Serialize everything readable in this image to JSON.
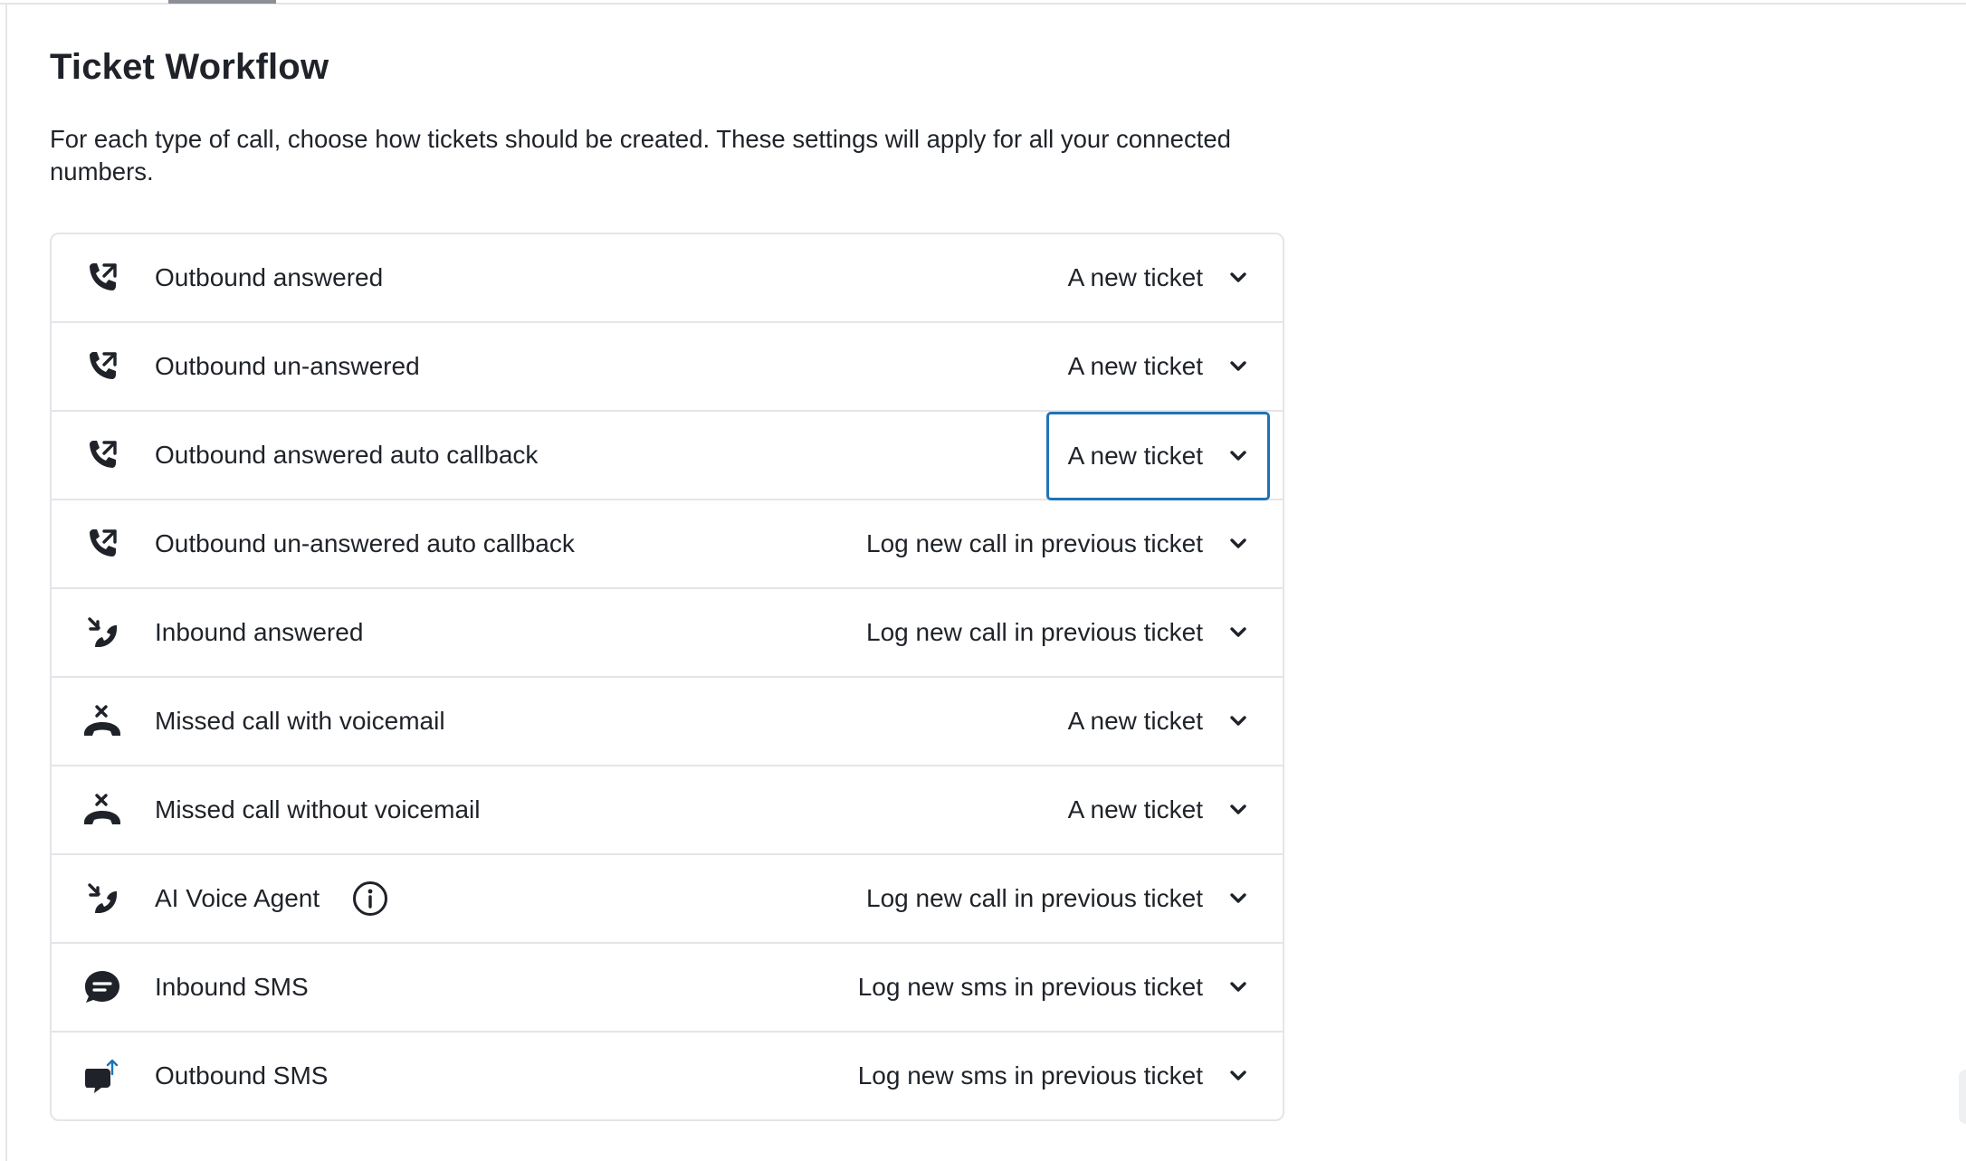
{
  "header": {
    "title": "Ticket Workflow",
    "description": "For each type of call, choose how tickets should be created. These settings will apply for all your connected numbers."
  },
  "rows": [
    {
      "label": "Outbound answered",
      "value": "A new ticket",
      "icon": "outbound-call-icon"
    },
    {
      "label": "Outbound un-answered",
      "value": "A new ticket",
      "icon": "outbound-call-icon"
    },
    {
      "label": "Outbound answered auto callback",
      "value": "A new ticket",
      "icon": "outbound-call-icon",
      "focused": true
    },
    {
      "label": "Outbound un-answered auto callback",
      "value": "Log new call in previous ticket",
      "icon": "outbound-call-icon"
    },
    {
      "label": "Inbound answered",
      "value": "Log new call in previous ticket",
      "icon": "inbound-call-icon"
    },
    {
      "label": "Missed call with voicemail",
      "value": "A new ticket",
      "icon": "missed-call-icon"
    },
    {
      "label": "Missed call without voicemail",
      "value": "A new ticket",
      "icon": "missed-call-icon"
    },
    {
      "label": "AI Voice Agent",
      "value": "Log new call in previous ticket",
      "icon": "inbound-call-icon",
      "info_icon": "info-icon"
    },
    {
      "label": "Inbound SMS",
      "value": "Log new sms in previous ticket",
      "icon": "sms-bubble-icon"
    },
    {
      "label": "Outbound SMS",
      "value": "Log new sms in previous ticket",
      "icon": "outbound-sms-icon"
    }
  ],
  "colors": {
    "text": "#1f2329",
    "border": "#e3e5e8",
    "focus": "#1f73b7",
    "sms_arrow": "#1f73b7"
  }
}
